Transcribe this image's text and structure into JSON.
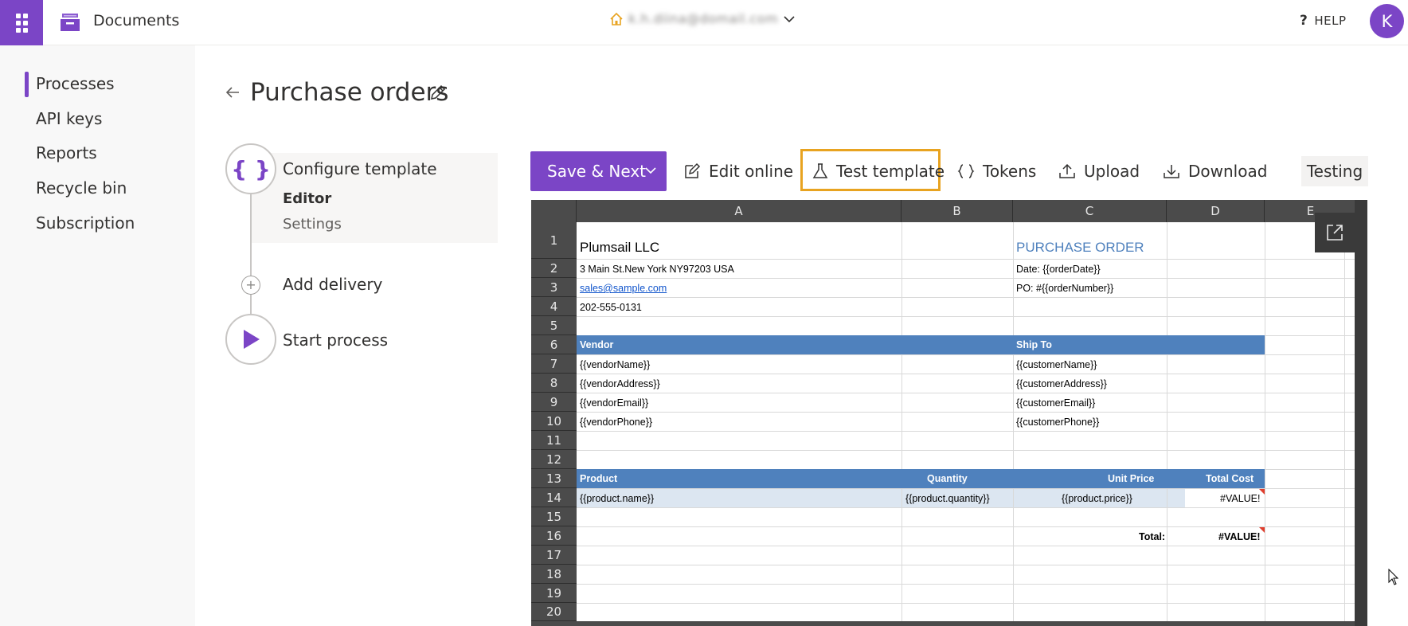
{
  "app": {
    "name": "Documents",
    "account_email": "k.h.diina@domail.com",
    "help_label": "HELP",
    "avatar_initial": "K",
    "accent_color": "#7b45c6"
  },
  "sidebar": {
    "items": [
      {
        "label": "Processes",
        "active": true
      },
      {
        "label": "API keys"
      },
      {
        "label": "Reports"
      },
      {
        "label": "Recycle bin"
      },
      {
        "label": "Subscription"
      }
    ]
  },
  "page": {
    "title": "Purchase orders"
  },
  "steps": {
    "configure": {
      "title": "Configure template",
      "sub1": "Editor",
      "sub2": "Settings",
      "icon": "braces-icon"
    },
    "delivery": {
      "title": "Add delivery",
      "icon": "plus-icon"
    },
    "start": {
      "title": "Start process",
      "icon": "play-icon"
    }
  },
  "toolbar": {
    "save_next": "Save & Next",
    "edit_online": "Edit online",
    "test_template": "Test template",
    "tokens": "Tokens",
    "upload": "Upload",
    "download": "Download",
    "testing": "Testing"
  },
  "sheet": {
    "columns": [
      "A",
      "B",
      "C",
      "D",
      "E"
    ],
    "rows": [
      "1",
      "2",
      "3",
      "4",
      "5",
      "6",
      "7",
      "8",
      "9",
      "10",
      "11",
      "12",
      "13",
      "14",
      "15",
      "16",
      "17",
      "18",
      "19",
      "20"
    ],
    "company": "Plumsail LLC",
    "doc_title": "PURCHASE ORDER",
    "address": "3 Main St.New York NY97203 USA",
    "email": "sales@sample.com",
    "phone": "202-555-0131",
    "date_line": "Date: {{orderDate}}",
    "po_line": "PO: #{{orderNumber}}",
    "vendor_header": "Vendor",
    "ship_header": "Ship To",
    "vendor_name": "{{vendorName}}",
    "vendor_address": "{{vendorAddress}}",
    "vendor_email": "{{vendorEmail}}",
    "vendor_phone": "{{vendorPhone}}",
    "customer_name": "{{customerName}}",
    "customer_address": "{{customerAddress}}",
    "customer_email": "{{customerEmail}}",
    "customer_phone": "{{customerPhone}}",
    "col_product": "Product",
    "col_quantity": "Quantity",
    "col_unit_price": "Unit Price",
    "col_total_cost": "Total Cost",
    "product_name": "{{product.name}}",
    "product_quantity": "{{product.quantity}}",
    "product_price": "{{product.price}}",
    "value_error": "#VALUE!",
    "total_label": "Total:",
    "total_value": "#VALUE!"
  }
}
